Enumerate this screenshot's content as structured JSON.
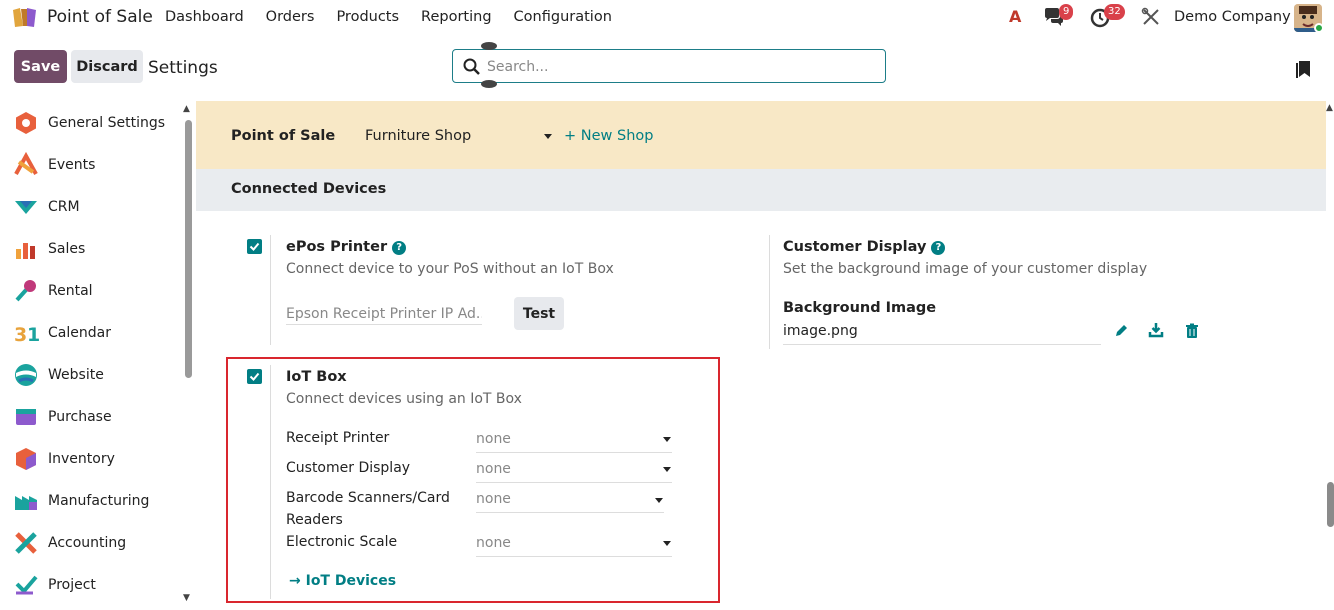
{
  "navbar": {
    "app_name": "Point of Sale",
    "menu": [
      "Dashboard",
      "Orders",
      "Products",
      "Reporting",
      "Configuration"
    ],
    "ai_label": "A",
    "messages_count": "9",
    "activities_count": "32",
    "company": "Demo Company"
  },
  "control_panel": {
    "save_label": "Save",
    "discard_label": "Discard",
    "title": "Settings",
    "search_placeholder": "Search..."
  },
  "sidebar": {
    "items": [
      {
        "label": "General Settings",
        "icon": "general-settings-icon"
      },
      {
        "label": "Events",
        "icon": "events-icon"
      },
      {
        "label": "CRM",
        "icon": "crm-icon"
      },
      {
        "label": "Sales",
        "icon": "sales-icon"
      },
      {
        "label": "Rental",
        "icon": "rental-icon"
      },
      {
        "label": "Calendar",
        "icon": "calendar-icon"
      },
      {
        "label": "Website",
        "icon": "website-icon"
      },
      {
        "label": "Purchase",
        "icon": "purchase-icon"
      },
      {
        "label": "Inventory",
        "icon": "inventory-icon"
      },
      {
        "label": "Manufacturing",
        "icon": "manufacturing-icon"
      },
      {
        "label": "Accounting",
        "icon": "accounting-icon"
      },
      {
        "label": "Project",
        "icon": "project-icon"
      }
    ]
  },
  "pos": {
    "label": "Point of Sale",
    "shop": "Furniture Shop",
    "new_shop": "+ New Shop"
  },
  "connected_devices": {
    "heading": "Connected Devices",
    "epos": {
      "title": "ePos Printer",
      "description": "Connect device to your PoS without an IoT Box",
      "ip_placeholder": "Epson Receipt Printer IP Ad...",
      "test_label": "Test",
      "checked": true
    },
    "customer_display": {
      "title": "Customer Display",
      "description": "Set the background image of your customer display",
      "bg_label": "Background Image",
      "bg_value": "image.png"
    },
    "iot": {
      "title": "IoT Box",
      "description": "Connect devices using an IoT Box",
      "checked": true,
      "fields": [
        {
          "label": "Receipt Printer",
          "value": "none"
        },
        {
          "label": "Customer Display",
          "value": "none"
        },
        {
          "label": "Barcode Scanners/Card",
          "label2": "Readers",
          "value": "none"
        },
        {
          "label": "Electronic Scale",
          "value": "none"
        }
      ],
      "link": "IoT Devices"
    }
  },
  "colors": {
    "primary": "#714b67",
    "accent": "#017e84",
    "band": "#f8e8c6",
    "highlight": "#d9262e"
  }
}
